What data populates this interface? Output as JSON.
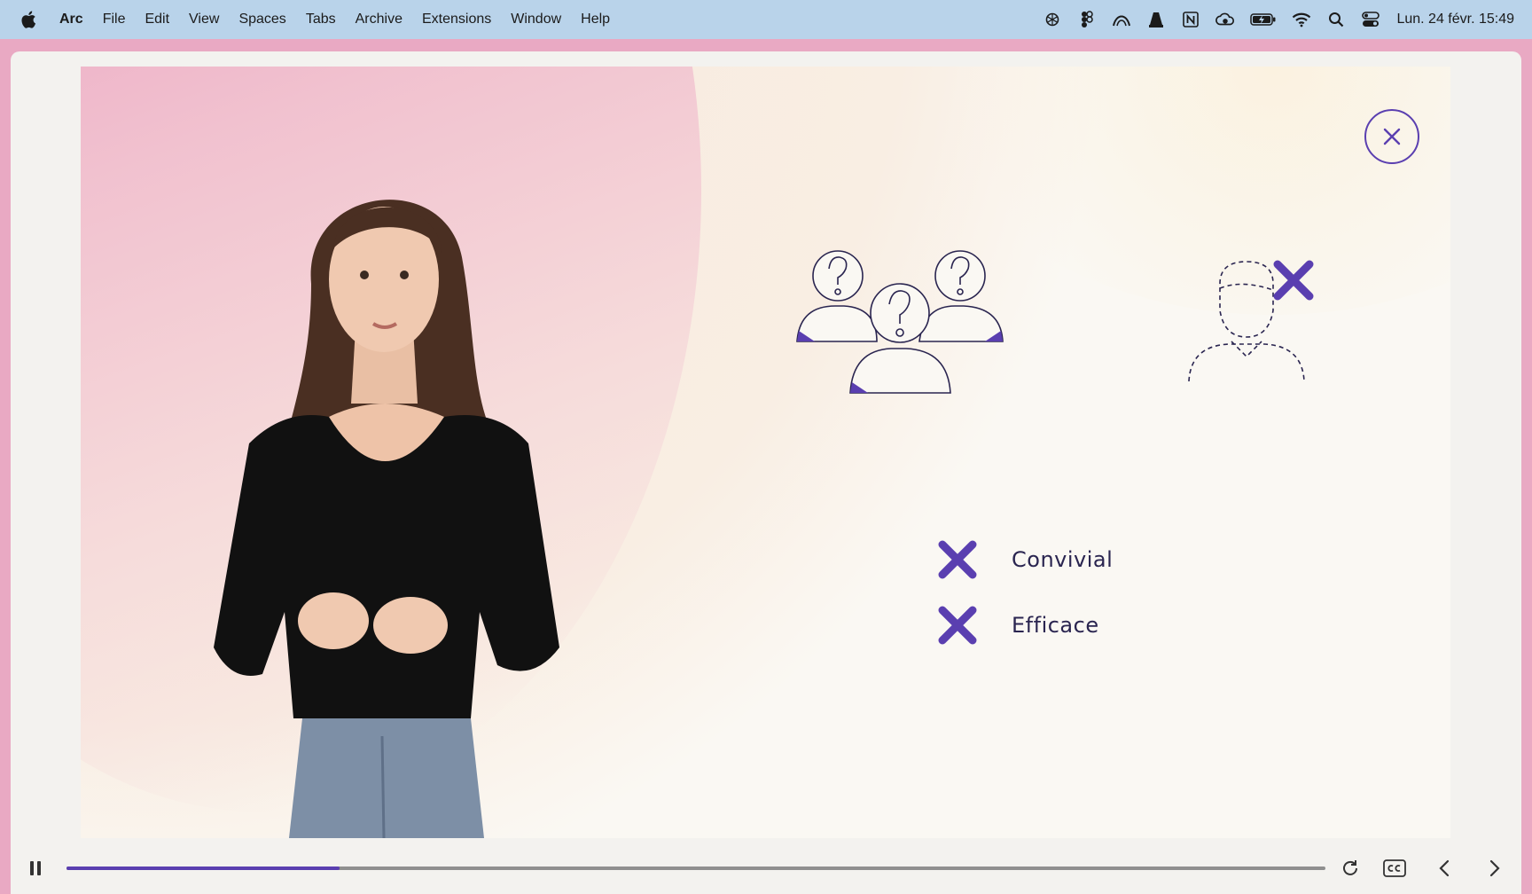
{
  "menubar": {
    "app": "Arc",
    "items": [
      "File",
      "Edit",
      "View",
      "Spaces",
      "Tabs",
      "Archive",
      "Extensions",
      "Window",
      "Help"
    ],
    "status_icons": [
      "chatgpt-icon",
      "figma-icon",
      "arc-icon",
      "vlc-icon",
      "notion-icon",
      "cloud-sync-icon",
      "battery-charging-icon",
      "wifi-icon",
      "search-icon",
      "control-center-icon"
    ],
    "clock": "Lun. 24 févr.  15:49"
  },
  "slide": {
    "checklist": [
      {
        "icon": "x-mark-icon",
        "label": "Convivial"
      },
      {
        "icon": "x-mark-icon",
        "label": "Efficace"
      }
    ],
    "illustrations": [
      "people-question-icon",
      "person-cross-icon"
    ]
  },
  "player": {
    "progress": 0.217,
    "state": "playing"
  },
  "colors": {
    "accent": "#5a3fb0",
    "menubar": "#b9d3ea",
    "background": "#faf8f3"
  }
}
